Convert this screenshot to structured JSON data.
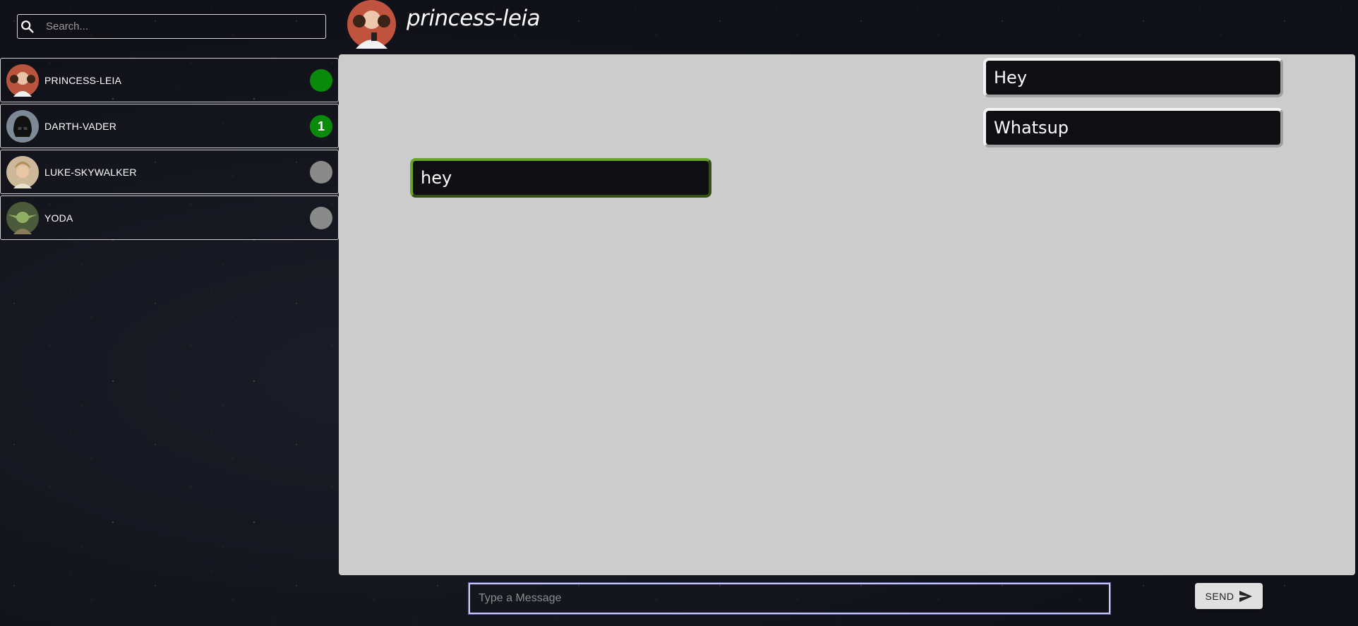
{
  "search": {
    "placeholder": "Search..."
  },
  "contacts": [
    {
      "name": "PRINCESS-LEIA",
      "status": "online",
      "badge": ""
    },
    {
      "name": "DARTH-VADER",
      "status": "online",
      "badge": "1"
    },
    {
      "name": "LUKE-SKYWALKER",
      "status": "offline",
      "badge": ""
    },
    {
      "name": "YODA",
      "status": "offline",
      "badge": ""
    }
  ],
  "header": {
    "title": "princess-leia"
  },
  "messages": [
    {
      "text": "Hey",
      "direction": "outgoing"
    },
    {
      "text": "Whatsup",
      "direction": "outgoing"
    },
    {
      "text": "hey",
      "direction": "incoming"
    }
  ],
  "composer": {
    "placeholder": "Type a Message",
    "send_label": "SEND"
  },
  "colors": {
    "online": "#0a8a0a",
    "offline": "#8a8a8a",
    "chat_bg": "#cccccc",
    "incoming_border": "#6aa329",
    "outgoing_border": "#f4f4f4"
  },
  "icons": {
    "search": "search-icon",
    "send": "send-icon"
  }
}
